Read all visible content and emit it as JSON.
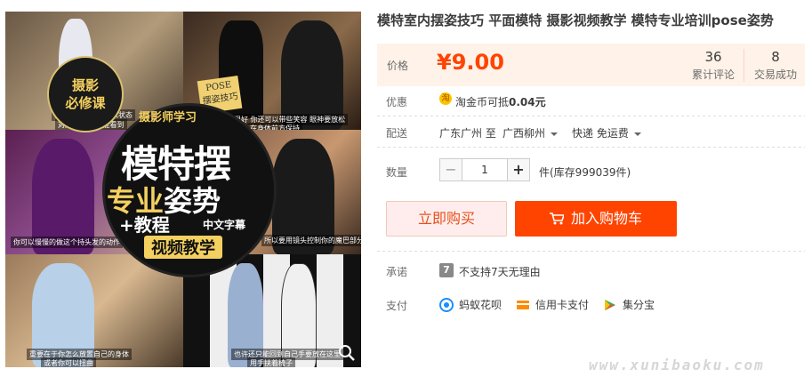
{
  "product": {
    "title": "模特室内摆姿技巧 平面模特 摄影视频教学 模特专业培训pose姿势"
  },
  "image": {
    "badge_line1": "摄影",
    "badge_line2": "必修课",
    "pose_tag_line1": "POSE",
    "pose_tag_line2": "摆姿技巧",
    "subtitle": "摄影师学习",
    "main_title": "模特摆",
    "pro_line_a": "专业",
    "pro_line_b": "姿势",
    "tutorial": "+教程",
    "chinese_sub": "中文字幕",
    "video_label": "视频教学",
    "caption_1": "你的手臂也开始进入状态",
    "caption_1b": "对照镜头 你就能看到",
    "caption_2": "很好 你还可以带些笑容 眼神要放松",
    "caption_2b": "在身体前方保持",
    "caption_3": "你可以慢慢的做这个持头发的动作",
    "caption_4": "所以要用镜头控制你的魔巴部分",
    "caption_5": "重要在于你怎么放置自己的身体",
    "caption_5b": "或者你可以扭曲",
    "caption_6": "也许还只能回到自己手要放在这里",
    "caption_6b": "用手扶着椅子"
  },
  "price": {
    "label": "价格",
    "value": "¥9.00",
    "reviews_count": "36",
    "reviews_label": "累计评论",
    "sold_count": "8",
    "sold_label": "交易成功"
  },
  "promo": {
    "label": "优惠",
    "coin_glyph": "淘",
    "text_prefix": "淘金币可抵",
    "text_amount": "0.04元"
  },
  "shipping": {
    "label": "配送",
    "from": "广东广州 至",
    "to": "广西柳州",
    "method": "快递 免运费"
  },
  "quantity": {
    "label": "数量",
    "minus": "−",
    "value": "1",
    "plus": "+",
    "stock": "件(库存999039件)"
  },
  "actions": {
    "buy_now": "立即购买",
    "add_to_cart": "加入购物车"
  },
  "promise": {
    "label": "承诺",
    "icon_glyph": "7",
    "text": "不支持7天无理由"
  },
  "payment": {
    "label": "支付",
    "methods": [
      {
        "name": "蚂蚁花呗",
        "icon": "huabei-icon",
        "color": "#1a8ffb"
      },
      {
        "name": "信用卡支付",
        "icon": "credit-card-icon",
        "color": "#ff8a00"
      },
      {
        "name": "集分宝",
        "icon": "jifenbao-icon",
        "color": "#2eae5a"
      }
    ]
  },
  "watermark": "www.xunibaoku.com",
  "colors": {
    "accent": "#ff4400",
    "price_bg": "#fff2e8",
    "buy_now_bg": "#ffeded"
  }
}
